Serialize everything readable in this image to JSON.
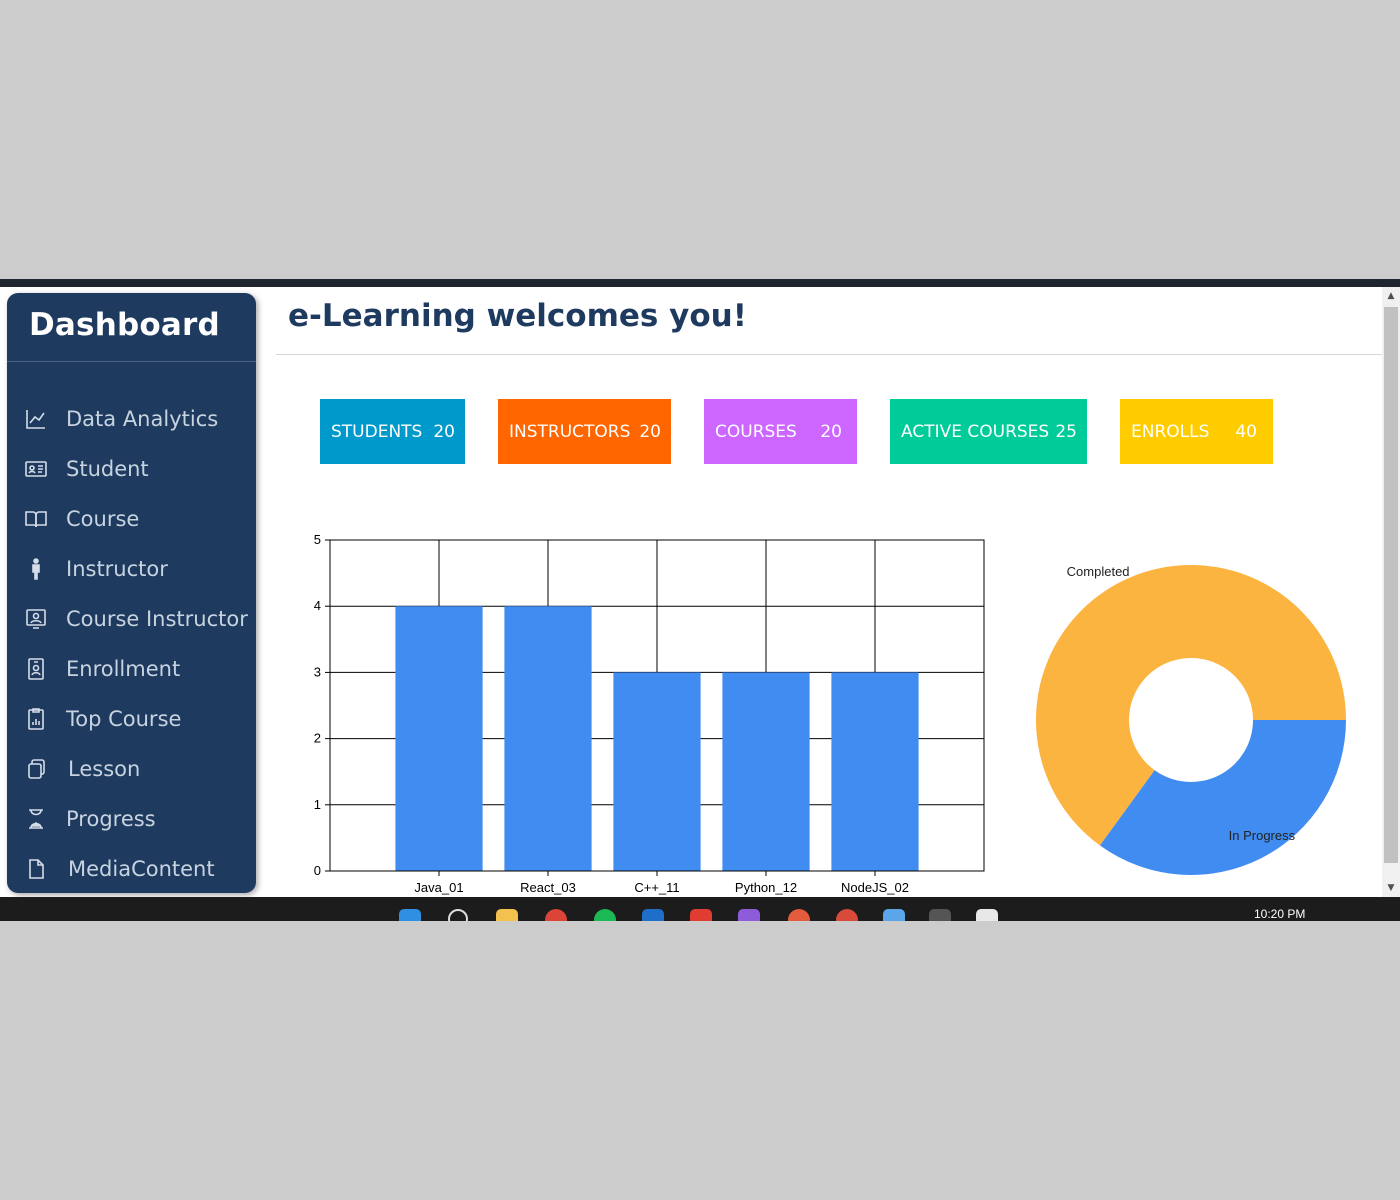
{
  "sidebar": {
    "title": "Dashboard",
    "items": [
      {
        "label": "Data Analytics",
        "icon": "chart-line-icon"
      },
      {
        "label": "Student",
        "icon": "id-card-icon"
      },
      {
        "label": "Course",
        "icon": "book-icon"
      },
      {
        "label": "Instructor",
        "icon": "person-icon"
      },
      {
        "label": "Course Instructor",
        "icon": "presenter-icon"
      },
      {
        "label": "Enrollment",
        "icon": "badge-icon"
      },
      {
        "label": "Top Course",
        "icon": "report-icon"
      },
      {
        "label": "Lesson",
        "icon": "copy-icon"
      },
      {
        "label": "Progress",
        "icon": "hourglass-icon"
      },
      {
        "label": "MediaContent",
        "icon": "file-icon"
      }
    ]
  },
  "header": {
    "title": "e-Learning welcomes you!"
  },
  "stats": [
    {
      "label": "STUDENTS",
      "value": "20",
      "color": "#0099cc"
    },
    {
      "label": "INSTRUCTORS",
      "value": "20",
      "color": "#ff6600"
    },
    {
      "label": "COURSES",
      "value": "20",
      "color": "#cc66ff"
    },
    {
      "label": "ACTIVE COURSES",
      "value": "25",
      "color": "#00cc99"
    },
    {
      "label": "ENROLLS",
      "value": "40",
      "color": "#ffcc00"
    }
  ],
  "chart_data": [
    {
      "type": "bar",
      "categories": [
        "Java_01",
        "React_03",
        "C++_11",
        "Python_12",
        "NodeJS_02"
      ],
      "values": [
        4,
        4,
        3,
        3,
        3
      ],
      "ylim": [
        0,
        5
      ],
      "yticks": [
        "0",
        "1",
        "2",
        "3",
        "4",
        "5"
      ],
      "grid": true,
      "color": "#418cf0"
    },
    {
      "type": "pie",
      "donut": true,
      "labels": [
        "Completed",
        "In Progress"
      ],
      "values": [
        65,
        35
      ],
      "colors": [
        "#fcb441",
        "#418cf0"
      ]
    }
  ],
  "taskbar": {
    "clock": "10:20 PM"
  }
}
